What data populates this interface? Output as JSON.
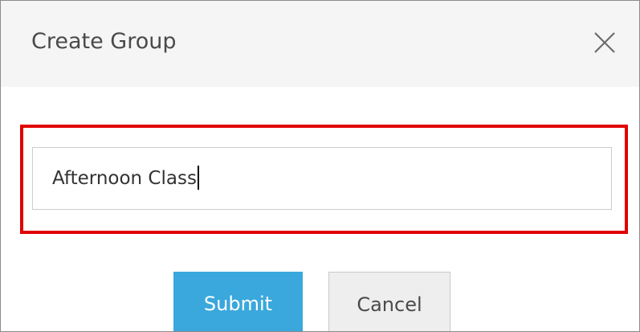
{
  "dialog": {
    "title": "Create Group",
    "close_icon": "close-x-icon"
  },
  "form": {
    "group_name_value": "Afternoon Class",
    "highlight_color": "#e00000"
  },
  "actions": {
    "submit_label": "Submit",
    "cancel_label": "Cancel",
    "submit_color": "#3aa8dc"
  }
}
